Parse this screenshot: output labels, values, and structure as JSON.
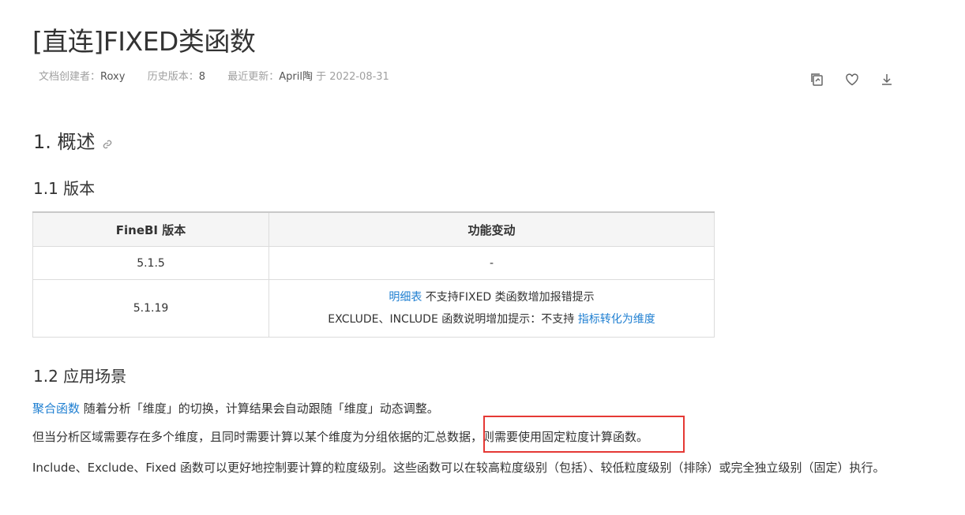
{
  "doc": {
    "title": "[直连]FIXED类函数",
    "meta": {
      "creator_label": "文档创建者：",
      "creator": "Roxy",
      "version_label": "历史版本：",
      "version": "8",
      "updated_label": "最近更新：",
      "updated_by": "April陶",
      "updated_on": "于 2022-08-31"
    },
    "actions": {
      "copy": "copy-icon",
      "favorite": "heart-icon",
      "download": "download-icon"
    }
  },
  "section1": {
    "heading": "1. 概述",
    "sub1": {
      "heading": "1.1 版本",
      "table": {
        "headers": [
          "FineBI 版本",
          "功能变动"
        ],
        "rows": [
          {
            "version": "5.1.5",
            "change": "-"
          },
          {
            "version": "5.1.19",
            "line1_link": "明细表",
            "line1_rest": " 不支持FIXED 类函数增加报错提示",
            "line2_text": "EXCLUDE、INCLUDE 函数说明增加提示：不支持 ",
            "line2_link": "指标转化为维度"
          }
        ]
      }
    },
    "sub2": {
      "heading": "1.2 应用场景",
      "p1_link": "聚合函数",
      "p1_rest": " 随着分析「维度」的切换，计算结果会自动跟随「维度」动态调整。",
      "p2": "但当分析区域需要存在多个维度，且同时需要计算以某个维度为分组依据的汇总数据，则需要使用固定粒度计算函数。",
      "p3": "Include、Exclude、Fixed 函数可以更好地控制要计算的粒度级别。这些函数可以在较高粒度级别（包括）、较低粒度级别（排除）或完全独立级别（固定）执行。"
    }
  },
  "colors": {
    "link": "#1f7fd1",
    "highlight": "#e53935"
  }
}
